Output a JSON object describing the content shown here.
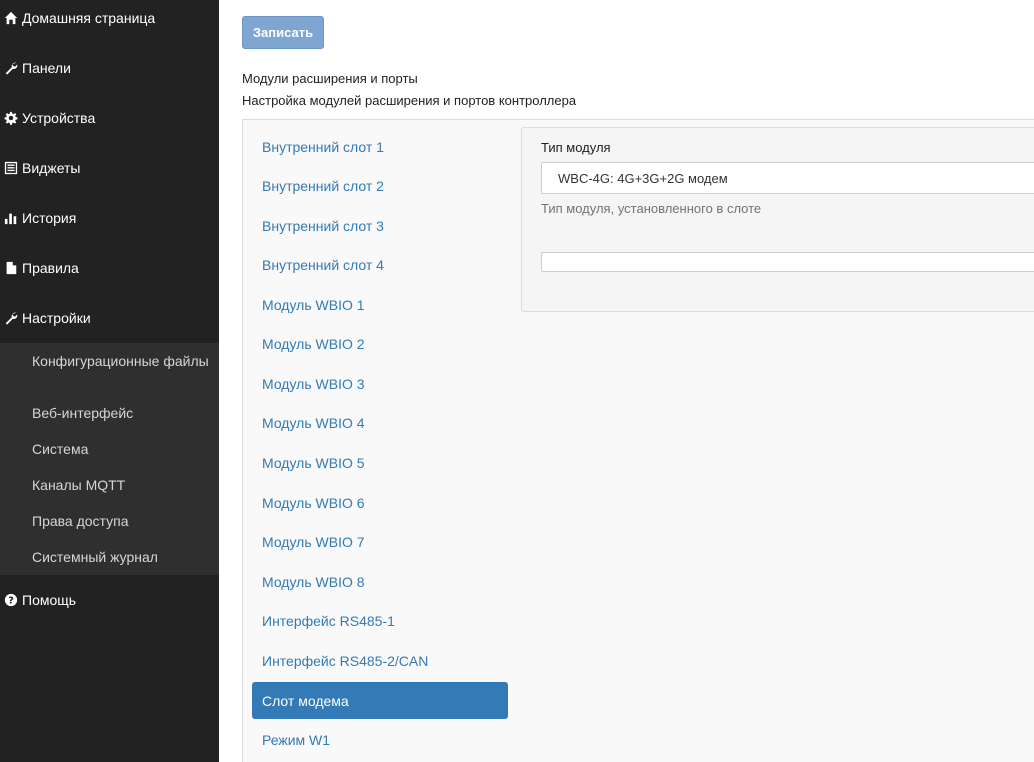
{
  "sidebar": {
    "items": [
      {
        "label": "Домашняя страница",
        "icon": "home-icon"
      },
      {
        "label": "Панели",
        "icon": "wrench-icon"
      },
      {
        "label": "Устройства",
        "icon": "gear-icon"
      },
      {
        "label": "Виджеты",
        "icon": "list-icon"
      },
      {
        "label": "История",
        "icon": "bar-chart-icon"
      },
      {
        "label": "Правила",
        "icon": "file-icon"
      },
      {
        "label": "Настройки",
        "icon": "wrench-icon"
      }
    ],
    "settings_sub": [
      {
        "label": "Конфигурационные файлы"
      },
      {
        "label": "Веб-интерфейс"
      },
      {
        "label": "Система"
      },
      {
        "label": "Каналы MQTT"
      },
      {
        "label": "Права доступа"
      },
      {
        "label": "Системный журнал"
      }
    ],
    "help": {
      "label": "Помощь",
      "icon": "question-circle-icon"
    }
  },
  "toolbar": {
    "save_label": "Записать"
  },
  "page": {
    "title": "Модули расширения и порты",
    "description": "Настройка модулей расширения и портов контроллера"
  },
  "tabs": [
    {
      "label": "Внутренний слот 1"
    },
    {
      "label": "Внутренний слот 2"
    },
    {
      "label": "Внутренний слот 3"
    },
    {
      "label": "Внутренний слот 4"
    },
    {
      "label": "Модуль WBIO 1"
    },
    {
      "label": "Модуль WBIO 2"
    },
    {
      "label": "Модуль WBIO 3"
    },
    {
      "label": "Модуль WBIO 4"
    },
    {
      "label": "Модуль WBIO 5"
    },
    {
      "label": "Модуль WBIO 6"
    },
    {
      "label": "Модуль WBIO 7"
    },
    {
      "label": "Модуль WBIO 8"
    },
    {
      "label": "Интерфейс RS485-1"
    },
    {
      "label": "Интерфейс RS485-2/CAN"
    },
    {
      "label": "Слот модема",
      "active": true
    },
    {
      "label": "Режим W1"
    }
  ],
  "form": {
    "module_type_label": "Тип модуля",
    "module_type_value": "WBC-4G: 4G+3G+2G модем",
    "module_type_help": "Тип модуля, установленного в слоте"
  },
  "colors": {
    "sidebar_bg": "#222222",
    "accent": "#337ab7",
    "save_button": "#7fa6d1"
  }
}
